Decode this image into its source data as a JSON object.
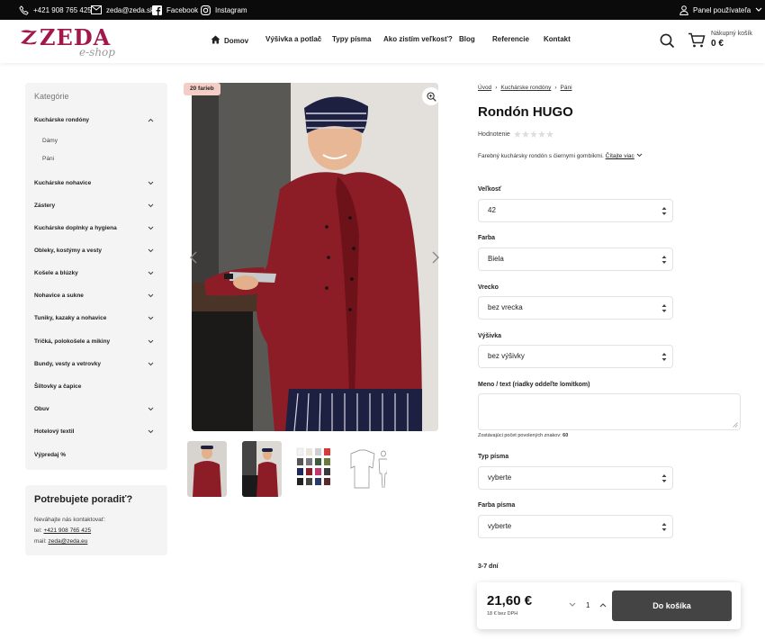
{
  "topbar": {
    "phone": "+421 908 765 425",
    "email": "zeda@zeda.sk",
    "facebook": "Facebook",
    "instagram": "Instagram",
    "user_panel": "Panel používateľa"
  },
  "header": {
    "logo_main": "ZEDA",
    "logo_sub": "e-shop",
    "nav": [
      "Domov",
      "Výšivka a potlač",
      "Typy písma",
      "Ako zistím veľkosť?",
      "Blog",
      "Referencie",
      "Kontakt"
    ],
    "cart_label": "Nákupný košík",
    "cart_total": "0 €"
  },
  "sidebar": {
    "title": "Kategórie",
    "categories": [
      "Kuchárske rondóny",
      "Kuchárske nohavice",
      "Zástery",
      "Kuchárske doplnky a hygiena",
      "Obleky, kostýmy a vesty",
      "Košele a blúzky",
      "Nohavice a sukne",
      "Tuniky, kazaky a nohavice",
      "Tričká, polokošele a mikiny",
      "Bundy, vesty a vetrovky",
      "Šiltovky a čapice",
      "Obuv",
      "Hotelový textil",
      "Výpredaj %"
    ],
    "subcategories": [
      "Dámy",
      "Páni"
    ]
  },
  "help": {
    "title": "Potrebujete poradiť?",
    "line1": "Neváhajte nás kontaktovať:",
    "tel_label": "tel: ",
    "tel": "+421 908 765 425",
    "mail_label": "mail: ",
    "mail": "zeda@zeda.eu"
  },
  "gallery": {
    "badge": "20 farieb"
  },
  "product": {
    "breadcrumb": [
      "Úvod",
      "Kuchárske rondóny",
      "Páni"
    ],
    "title": "Rondón HUGO",
    "rating_label": "Hodnotenie",
    "rating_value": 0,
    "description": "Farebný kuchársky rondón s čiernymi gombíkmi.",
    "read_more": "Čítajte viac",
    "size_label": "Veľkosť",
    "size_value": "42",
    "color_label": "Farba",
    "color_value": "Biela",
    "pocket_label": "Vrecko",
    "pocket_value": "bez vrecka",
    "embroidery_label": "Výšivka",
    "embroidery_value": "bez výšivky",
    "name_label": "Meno / text (riadky oddeľte lomítkom)",
    "remaining_note": "Zostávajúci počet povolených znakov:",
    "remaining_count": "60",
    "font_type_label": "Typ písma",
    "font_type_value": "vyberte",
    "font_color_label": "Farba písma",
    "font_color_value": "vyberte",
    "delivery": "3-7 dní"
  },
  "buy": {
    "price": "21,60 €",
    "net_price": "18 € bez DPH",
    "quantity": "1",
    "add_to_cart": "Do košíka"
  },
  "colors": {
    "brand": "#a3184a",
    "topbar": "#0b0b0b",
    "button": "#444444",
    "badge": "#f4cdc6",
    "panel": "#f4f4f4"
  }
}
